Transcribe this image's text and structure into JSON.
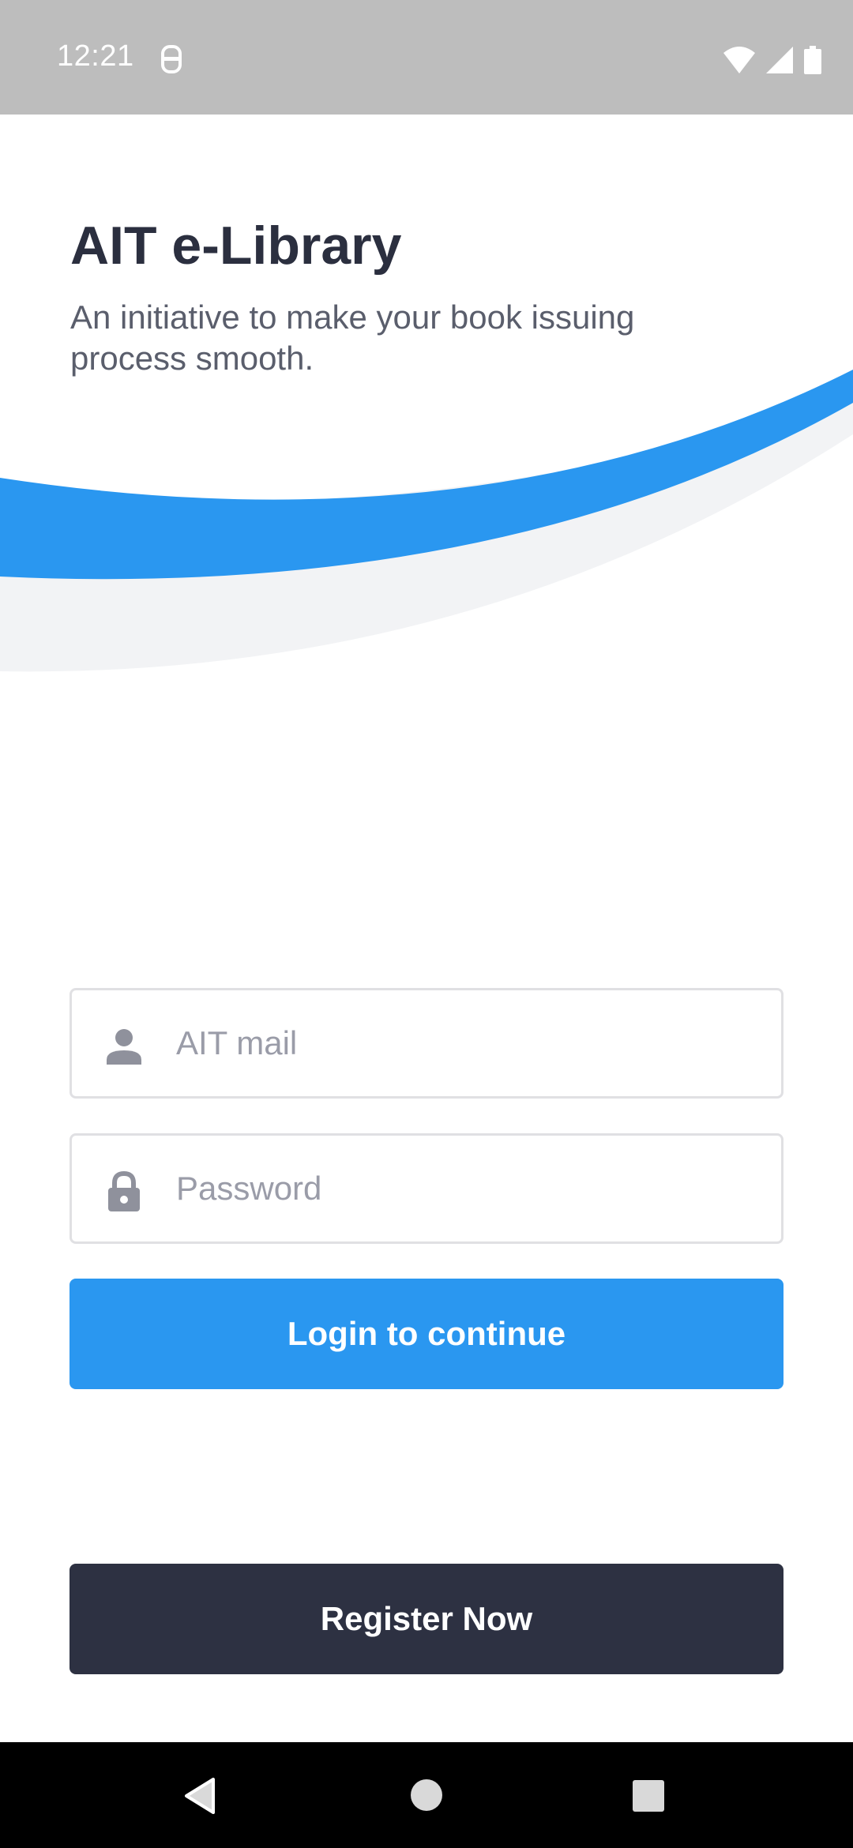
{
  "status_bar": {
    "time": "12:21",
    "icons": [
      "notification-icon",
      "wifi-icon",
      "cell-signal-icon",
      "battery-icon"
    ]
  },
  "header": {
    "title": "AIT e-Library",
    "subtitle": "An initiative to make your book issuing process smooth."
  },
  "form": {
    "email_placeholder": "AIT mail",
    "email_icon": "person-icon",
    "password_placeholder": "Password",
    "password_icon": "lock-icon",
    "login_label": "Login to continue"
  },
  "register": {
    "label": "Register Now"
  },
  "colors": {
    "accent": "#2a97f0",
    "dark": "#2d3142",
    "title": "#2b2f3f",
    "wave_light": "#f2f3f5"
  },
  "nav_bar": {
    "icons": [
      "back-icon",
      "home-icon",
      "recents-icon"
    ]
  }
}
